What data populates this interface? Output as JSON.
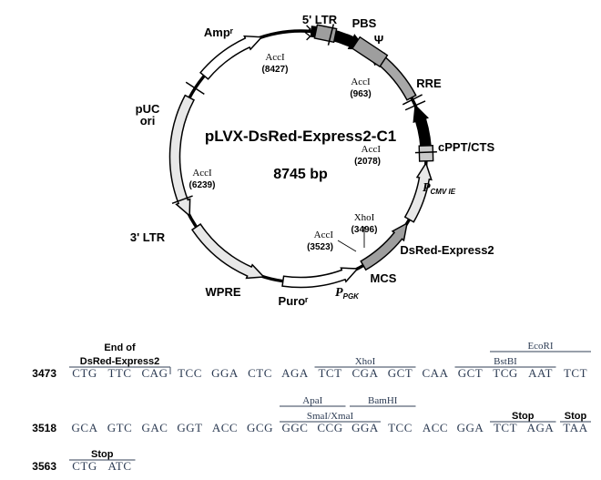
{
  "plasmid": {
    "name": "pLVX-DsRed-Express2-C1",
    "size": "8745 bp",
    "features": [
      {
        "id": "amp",
        "label": "Ampʳ",
        "fill": "#e8e8e8",
        "a0": -118,
        "a1": -62,
        "dir": "ccw"
      },
      {
        "id": "puc",
        "label": "pUC\nori",
        "fill": "#e8e8e8",
        "a0": -163,
        "a1": -124,
        "dir": "ccw"
      },
      {
        "id": "ltr3",
        "label": "3' LTR",
        "fill": "#ffffff",
        "a0": 153,
        "a1": 188,
        "dir": "ccw"
      },
      {
        "id": "wpre",
        "label": "WPRE",
        "fill": "#9e9e9e",
        "a0": 122,
        "a1": 150,
        "dir": "ccw"
      },
      {
        "id": "puro",
        "label": "Puroʳ",
        "fill": "#e8e8e8",
        "a0": 93,
        "a1": 120,
        "dir": "ccw"
      },
      {
        "id": "ppgk",
        "label": "P",
        "sublabel": "PGK",
        "fill": "#000000",
        "a0": 66,
        "a1": 90,
        "dir": "ccw"
      },
      {
        "id": "dsred",
        "label": "DsRed-Express2",
        "fill": "#a8a8a8",
        "a0": 32,
        "a1": 62,
        "dir": "ccw"
      },
      {
        "id": "pcmv",
        "label": "P",
        "sublabel": "CMV IE",
        "fill": "#000000",
        "a0": 5,
        "a1": 31,
        "dir": "cw"
      },
      {
        "id": "ltr5",
        "label": "5' LTR",
        "fill": "#ffffff",
        "a0": -50,
        "a1": -18,
        "dir": "cw"
      }
    ],
    "boxes": [
      {
        "id": "psi",
        "label": "Ψ",
        "fill": "#9e9e9e",
        "a0": 7,
        "a1": 16,
        "side": "outer"
      },
      {
        "id": "rre",
        "label": "RRE",
        "fill": "#9e9e9e",
        "a0": 26,
        "a1": 41,
        "side": "outer"
      },
      {
        "id": "cppt",
        "label": "cPPT/CTS",
        "fill": "#c9c9c9",
        "a0": 85,
        "a1": 92,
        "side": "outer"
      }
    ],
    "point_labels": [
      {
        "id": "pbs",
        "label": "PBS"
      },
      {
        "id": "mcs",
        "label": "MCS"
      }
    ],
    "cut_sites": [
      {
        "id": "acci-8427",
        "enzyme": "AccI",
        "position": "(8427)"
      },
      {
        "id": "acci-963",
        "enzyme": "AccI",
        "position": "(963)"
      },
      {
        "id": "acci-2078",
        "enzyme": "AccI",
        "position": "(2078)"
      },
      {
        "id": "acci-3523",
        "enzyme": "AccI",
        "position": "(3523)"
      },
      {
        "id": "xhoi-3496",
        "enzyme": "XhoI",
        "position": "(3496)"
      },
      {
        "id": "acci-6239",
        "enzyme": "AccI",
        "position": "(6239)"
      }
    ]
  },
  "sequence": {
    "rows": [
      {
        "number": "3473",
        "codons": [
          "CTG",
          "TTC",
          "CAG",
          "TCC",
          "GGA",
          "CTC",
          "AGA",
          "TCT",
          "CGA",
          "GCT",
          "CAA",
          "GCT",
          "TCG",
          "AAT",
          "TCT"
        ],
        "annotations": [
          {
            "label": "End of\nDsRed-Express2",
            "start": 0,
            "end": 2,
            "tier": 0,
            "bold": true,
            "bracket": true
          },
          {
            "label": "XhoI",
            "start": 7,
            "end": 9,
            "tier": 0,
            "bold": false
          },
          {
            "label": "BstBI",
            "start": 11,
            "end": 13,
            "tier": 0,
            "bold": false
          },
          {
            "label": "EcoRI",
            "start": 12,
            "end": 14,
            "tier": 1,
            "bold": false
          }
        ]
      },
      {
        "number": "3518",
        "codons": [
          "GCA",
          "GTC",
          "GAC",
          "GGT",
          "ACC",
          "GCG",
          "GGC",
          "CCG",
          "GGA",
          "TCC",
          "ACC",
          "GGA",
          "TCT",
          "AGA",
          "TAA"
        ],
        "annotations": [
          {
            "label": "ApaI",
            "start": 6,
            "end": 7,
            "tier": 1,
            "bold": false
          },
          {
            "label": "SmaI/XmaI",
            "start": 6,
            "end": 8,
            "tier": 0,
            "bold": false
          },
          {
            "label": "BamHI",
            "start": 8,
            "end": 9,
            "tier": 1,
            "bold": false
          },
          {
            "label": "Stop",
            "start": 12,
            "end": 13,
            "tier": 0,
            "bold": true
          },
          {
            "label": "Stop",
            "start": 14,
            "end": 14,
            "tier": 0,
            "bold": true
          }
        ]
      },
      {
        "number": "3563",
        "codons": [
          "CTG",
          "ATC"
        ],
        "annotations": [
          {
            "label": "Stop",
            "start": 0,
            "end": 1,
            "tier": 0,
            "bold": true
          }
        ]
      }
    ]
  },
  "colors": {
    "backbone": "#000000",
    "light_gray": "#e8e8e8",
    "mid_gray": "#9e9e9e",
    "dark_text": "#000000",
    "seq_text": "#2b3a52"
  }
}
